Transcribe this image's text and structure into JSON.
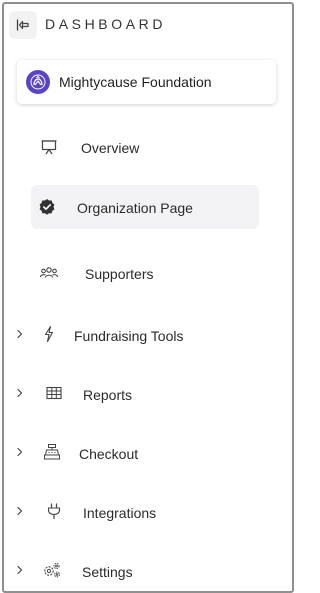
{
  "header": {
    "title": "DASHBOARD",
    "collapse_icon": "collapse-sidebar-icon"
  },
  "organization": {
    "name": "Mightycause Foundation",
    "avatar_color": "#5a43c8"
  },
  "nav": {
    "overview": {
      "label": "Overview",
      "icon": "presentation-board-icon"
    },
    "organization_page": {
      "label": "Organization Page",
      "icon": "verified-badge-icon",
      "active": true
    },
    "supporters": {
      "label": "Supporters",
      "icon": "group-icon"
    },
    "fundraising_tools": {
      "label": "Fundraising Tools",
      "icon": "lightning-icon",
      "expandable": true
    },
    "reports": {
      "label": "Reports",
      "icon": "table-icon",
      "expandable": true
    },
    "checkout": {
      "label": "Checkout",
      "icon": "cash-register-icon",
      "expandable": true
    },
    "integrations": {
      "label": "Integrations",
      "icon": "plug-icon",
      "expandable": true
    },
    "settings": {
      "label": "Settings",
      "icon": "gears-icon",
      "expandable": true
    }
  },
  "colors": {
    "border": "#8f8f8f",
    "active_bg": "#f3f3f5",
    "text": "#2b2b2b"
  }
}
